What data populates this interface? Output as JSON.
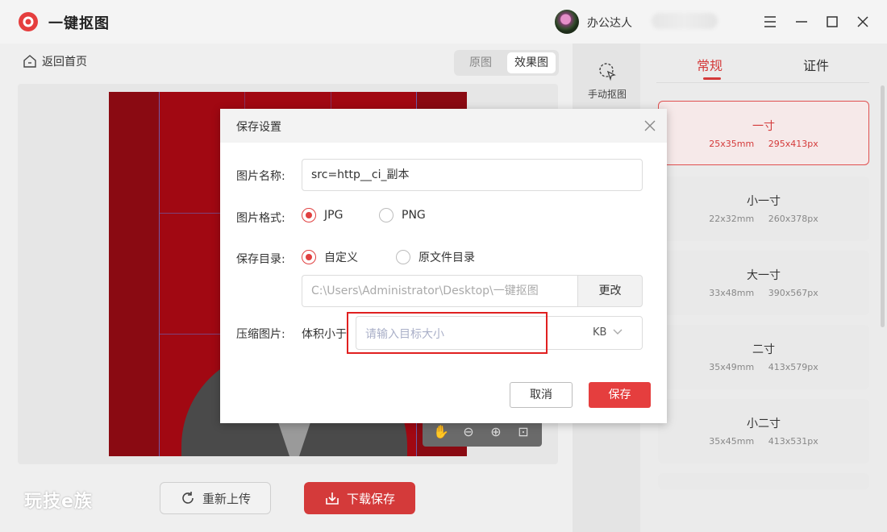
{
  "app": {
    "title": "一键抠图",
    "user_name": "办公达人"
  },
  "nav": {
    "back_label": "返回首页",
    "view_original": "原图",
    "view_effect": "效果图"
  },
  "tools": {
    "manual_cutout": "手动抠图"
  },
  "bottom": {
    "watermark": "玩技e族",
    "reupload": "重新上传",
    "download": "下载保存"
  },
  "right_panel": {
    "tabs": [
      "常规",
      "证件"
    ],
    "active_tab": "常规",
    "sizes": [
      {
        "name": "一寸",
        "mm": "25x35mm",
        "px": "295x413px",
        "active": true
      },
      {
        "name": "小一寸",
        "mm": "22x32mm",
        "px": "260x378px"
      },
      {
        "name": "大一寸",
        "mm": "33x48mm",
        "px": "390x567px"
      },
      {
        "name": "二寸",
        "mm": "35x49mm",
        "px": "413x579px"
      },
      {
        "name": "小二寸",
        "mm": "35x45mm",
        "px": "413x531px"
      }
    ]
  },
  "dialog": {
    "title": "保存设置",
    "name_label": "图片名称:",
    "name_value": "src=http__ci_副本",
    "format_label": "图片格式:",
    "format_options": [
      "JPG",
      "PNG"
    ],
    "format_selected": "JPG",
    "dir_label": "保存目录:",
    "dir_options": [
      "自定义",
      "原文件目录"
    ],
    "dir_selected": "自定义",
    "dir_path": "C:\\Users\\Administrator\\Desktop\\一键抠图",
    "dir_change": "更改",
    "compress_label": "压缩图片:",
    "compress_prefix": "体积小于",
    "compress_placeholder": "请输入目标大小",
    "compress_unit": "KB",
    "cancel": "取消",
    "save": "保存"
  },
  "colors": {
    "accent": "#e53e3e",
    "background_red": "#a10812"
  }
}
